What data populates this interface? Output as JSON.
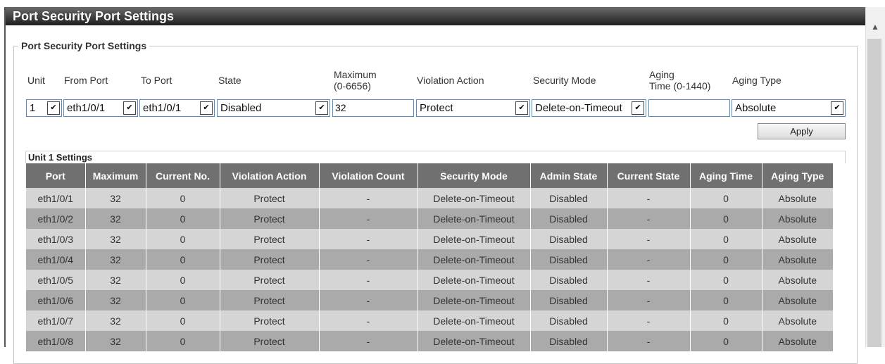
{
  "page": {
    "title": "Port Security Port Settings"
  },
  "form": {
    "legend": "Port Security Port Settings",
    "labels": {
      "unit": "Unit",
      "from_port": "From Port",
      "to_port": "To Port",
      "state": "State",
      "maximum_line1": "Maximum",
      "maximum_line2": "(0-6656)",
      "violation_action": "Violation Action",
      "security_mode": "Security Mode",
      "aging_time_line1": "Aging",
      "aging_time_line2": "Time (0-1440)",
      "aging_type": "Aging Type"
    },
    "values": {
      "unit": "1",
      "from_port": "eth1/0/1",
      "to_port": "eth1/0/1",
      "state": "Disabled",
      "maximum": "32",
      "violation_action": "Protect",
      "security_mode": "Delete-on-Timeout",
      "aging_time": "",
      "aging_type": "Absolute"
    },
    "apply_label": "Apply"
  },
  "table": {
    "title": "Unit 1 Settings",
    "columns": [
      "Port",
      "Maximum",
      "Current No.",
      "Violation Action",
      "Violation Count",
      "Security Mode",
      "Admin State",
      "Current State",
      "Aging Time",
      "Aging Type"
    ],
    "rows": [
      [
        "eth1/0/1",
        "32",
        "0",
        "Protect",
        "-",
        "Delete-on-Timeout",
        "Disabled",
        "-",
        "0",
        "Absolute"
      ],
      [
        "eth1/0/2",
        "32",
        "0",
        "Protect",
        "-",
        "Delete-on-Timeout",
        "Disabled",
        "-",
        "0",
        "Absolute"
      ],
      [
        "eth1/0/3",
        "32",
        "0",
        "Protect",
        "-",
        "Delete-on-Timeout",
        "Disabled",
        "-",
        "0",
        "Absolute"
      ],
      [
        "eth1/0/4",
        "32",
        "0",
        "Protect",
        "-",
        "Delete-on-Timeout",
        "Disabled",
        "-",
        "0",
        "Absolute"
      ],
      [
        "eth1/0/5",
        "32",
        "0",
        "Protect",
        "-",
        "Delete-on-Timeout",
        "Disabled",
        "-",
        "0",
        "Absolute"
      ],
      [
        "eth1/0/6",
        "32",
        "0",
        "Protect",
        "-",
        "Delete-on-Timeout",
        "Disabled",
        "-",
        "0",
        "Absolute"
      ],
      [
        "eth1/0/7",
        "32",
        "0",
        "Protect",
        "-",
        "Delete-on-Timeout",
        "Disabled",
        "-",
        "0",
        "Absolute"
      ],
      [
        "eth1/0/8",
        "32",
        "0",
        "Protect",
        "-",
        "Delete-on-Timeout",
        "Disabled",
        "-",
        "0",
        "Absolute"
      ]
    ]
  },
  "icons": {
    "dropdown": "chevron-down-icon",
    "scroll_up": "chevron-up-icon"
  }
}
